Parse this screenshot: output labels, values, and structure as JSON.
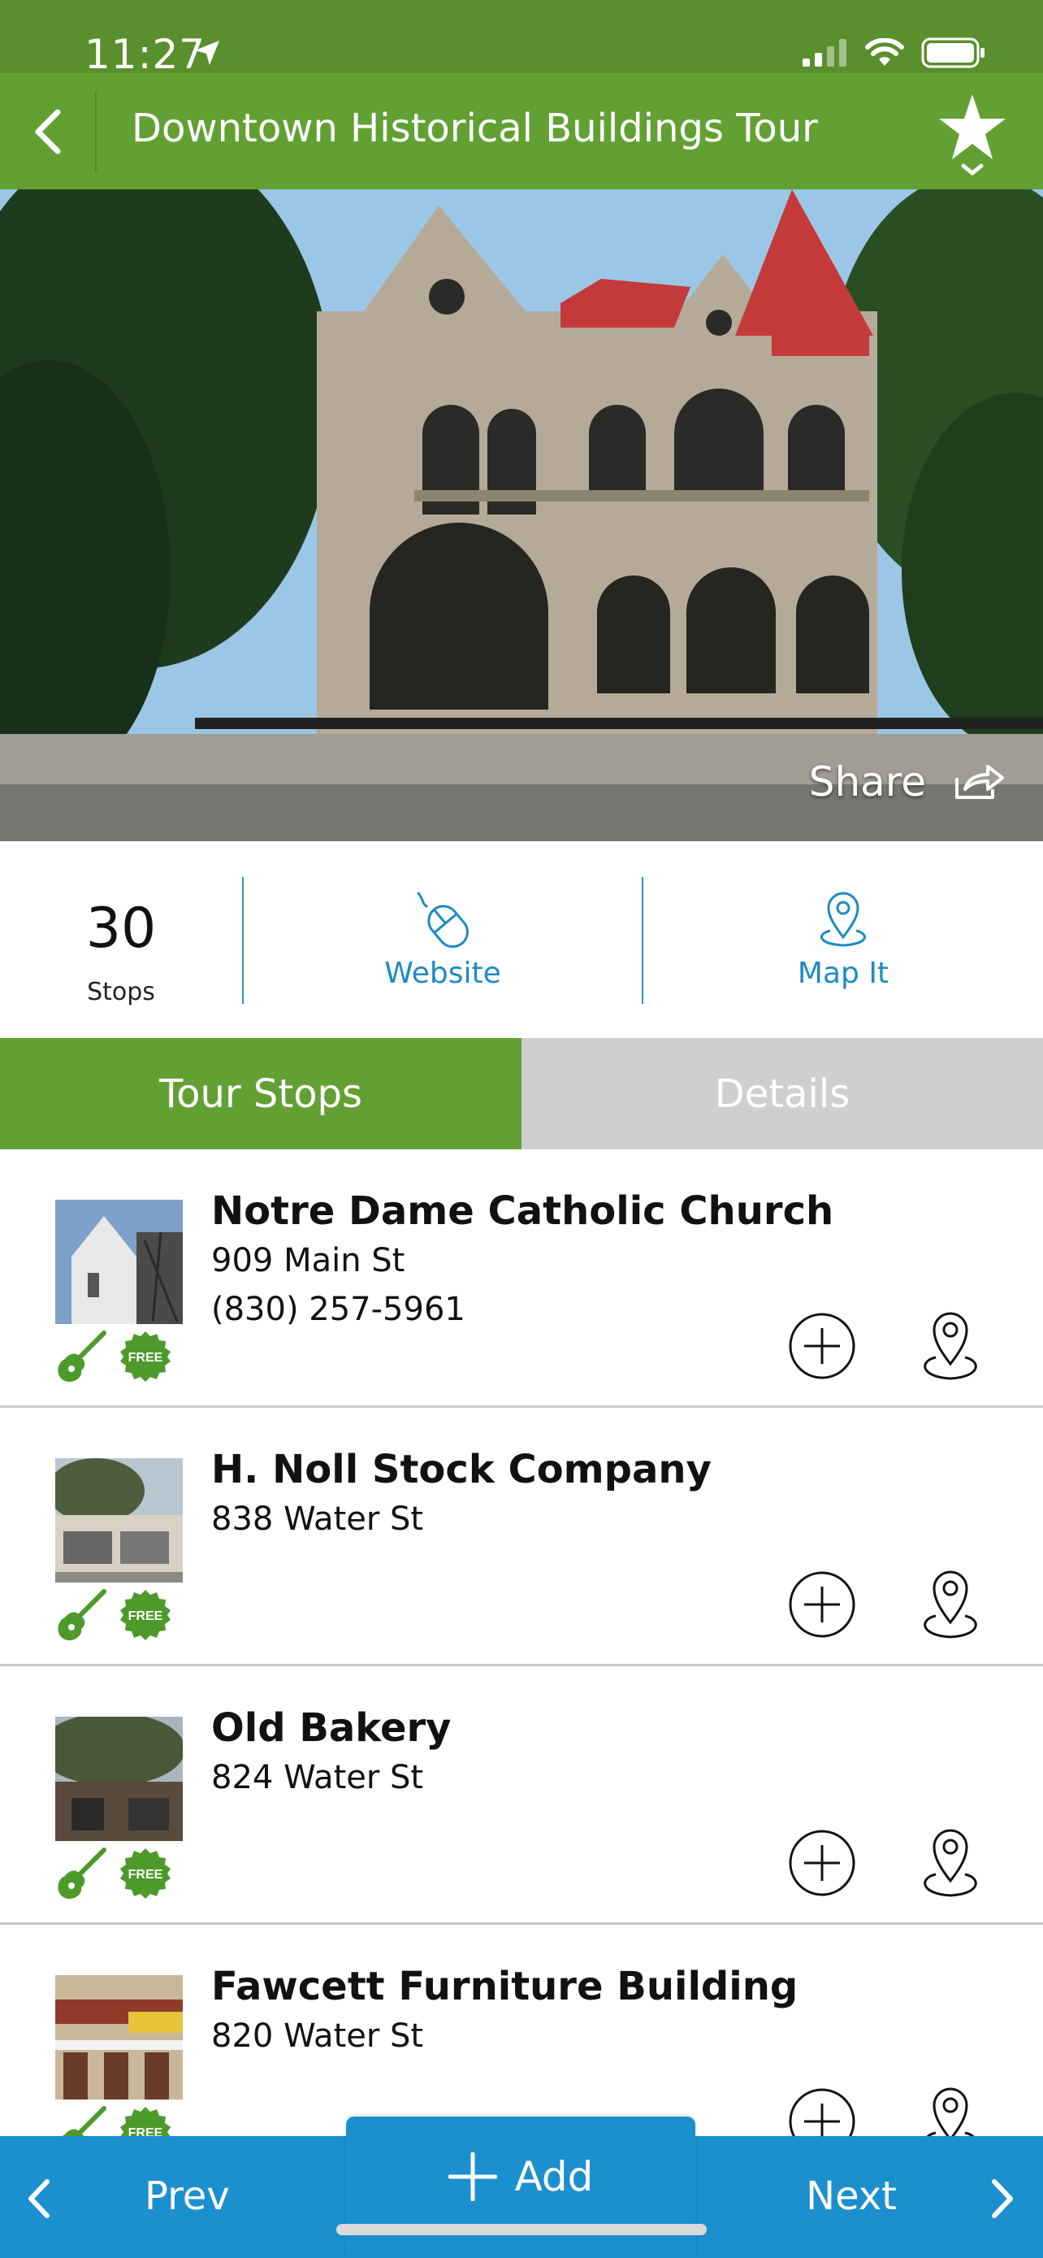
{
  "status_bar": {
    "time": "11:27"
  },
  "header": {
    "title": "Downtown Historical Buildings Tour"
  },
  "hero": {
    "share_label": "Share"
  },
  "stats": {
    "stops_count": "30",
    "stops_label": "Stops",
    "website_label": "Website",
    "map_label": "Map It"
  },
  "tabs": {
    "tour_stops": "Tour Stops",
    "details": "Details"
  },
  "stops": [
    {
      "name": "Notre Dame Catholic Church",
      "address": "909 Main St",
      "phone": "(830) 257-5961"
    },
    {
      "name": "H. Noll Stock Company",
      "address": "838 Water St",
      "phone": ""
    },
    {
      "name": "Old Bakery",
      "address": "824 Water St",
      "phone": ""
    },
    {
      "name": "Fawcett Furniture Building",
      "address": "820 Water St",
      "phone": ""
    }
  ],
  "badge_text": "FREE",
  "bottom_nav": {
    "prev": "Prev",
    "add": "Add",
    "next": "Next"
  },
  "colors": {
    "green": "#63a033",
    "blue": "#1c8fcf",
    "grey_tab": "#cfcfcf"
  },
  "icons": [
    "back-chevron-icon",
    "star-icon",
    "share-icon",
    "mouse-icon",
    "map-pin-icon",
    "guitar-icon",
    "free-badge-icon",
    "add-circle-icon"
  ]
}
